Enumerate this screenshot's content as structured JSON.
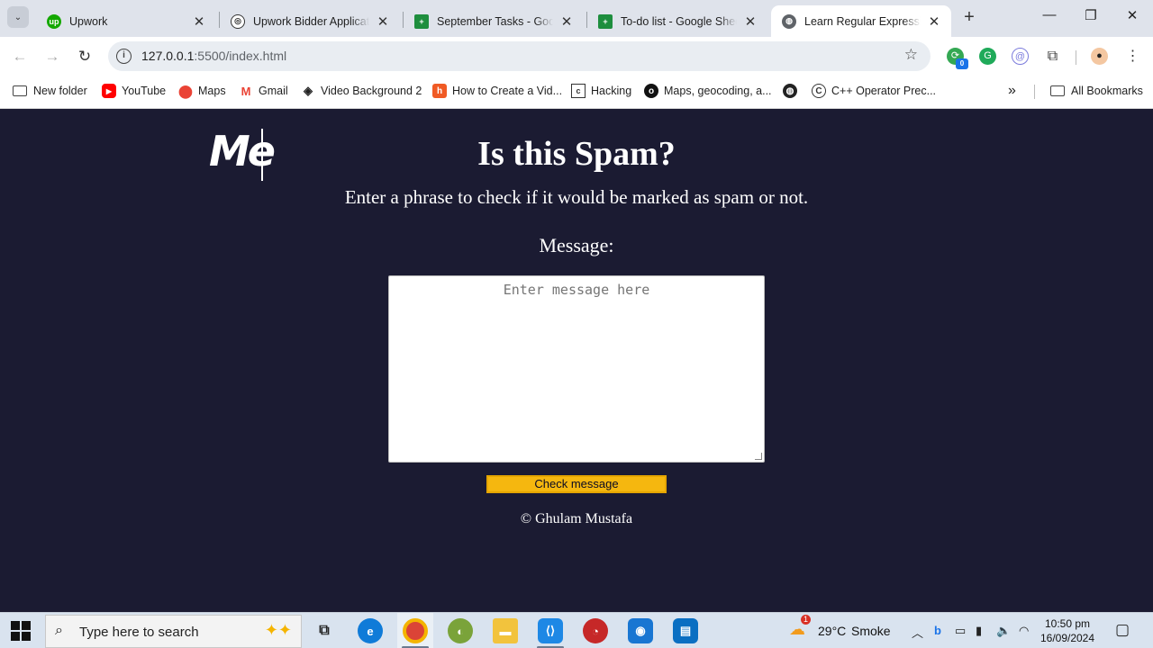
{
  "browser": {
    "tabs": [
      {
        "title": "Upwork",
        "active": false
      },
      {
        "title": "Upwork Bidder Applicati",
        "active": false
      },
      {
        "title": "September Tasks - Googl",
        "active": false
      },
      {
        "title": "To-do list - Google Sheet",
        "active": false
      },
      {
        "title": "Learn Regular Expression",
        "active": true
      }
    ],
    "new_tab_label": "+",
    "url_host": "127.0.0.1",
    "url_path": ":5500/index.html",
    "extension_badge": "0",
    "bookmarks": [
      "New folder",
      "YouTube",
      "Maps",
      "Gmail",
      "Video Background 2",
      "How to Create a Vid...",
      "Hacking",
      "Maps, geocoding, a...",
      "",
      "C++ Operator Prec..."
    ],
    "bookmarks_overflow": "»",
    "all_bookmarks": "All Bookmarks"
  },
  "page": {
    "logo": "Me",
    "heading": "Is this Spam?",
    "description": "Enter a phrase to check if it would be marked as spam or not.",
    "message_label": "Message:",
    "message_placeholder": "Enter message here",
    "check_button": "Check message",
    "footer": "© Ghulam Mustafa"
  },
  "taskbar": {
    "search_placeholder": "Type here to search",
    "weather_temp": "29°C",
    "weather_desc": "Smoke",
    "weather_badge": "1",
    "time": "10:50 pm",
    "date": "16/09/2024"
  },
  "colors": {
    "page_bg": "#1b1b32",
    "button_bg": "#f5b70f",
    "tab_strip": "#dfe3eb"
  }
}
